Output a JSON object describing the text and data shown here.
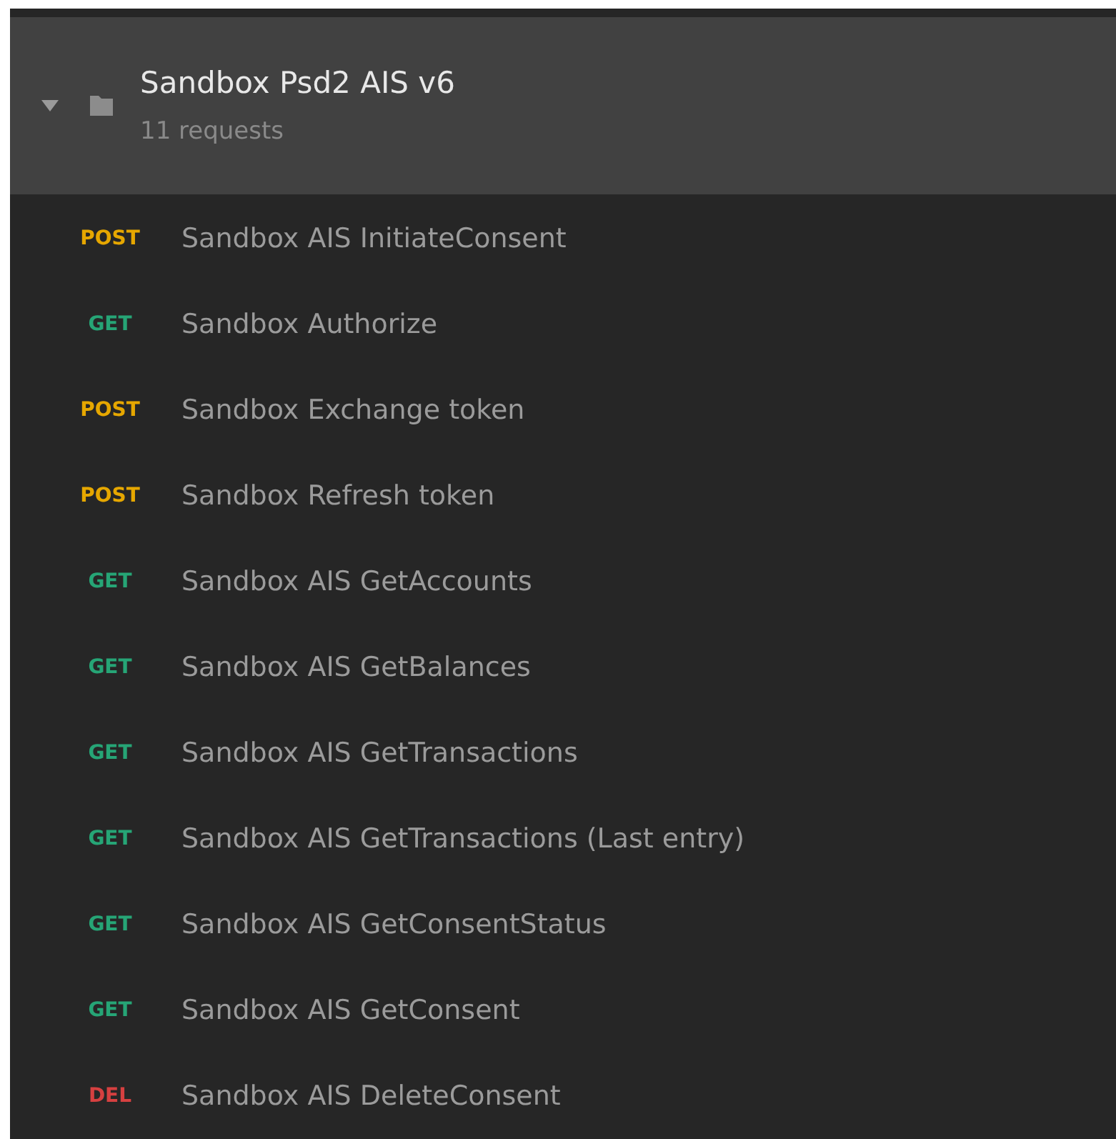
{
  "collection": {
    "title": "Sandbox Psd2 AIS v6",
    "subtitle": "11 requests",
    "expanded": true
  },
  "requests": [
    {
      "method": "POST",
      "kind": "post",
      "name": "Sandbox AIS InitiateConsent"
    },
    {
      "method": "GET",
      "kind": "get",
      "name": "Sandbox Authorize"
    },
    {
      "method": "POST",
      "kind": "post",
      "name": "Sandbox Exchange token"
    },
    {
      "method": "POST",
      "kind": "post",
      "name": "Sandbox Refresh token"
    },
    {
      "method": "GET",
      "kind": "get",
      "name": "Sandbox AIS GetAccounts"
    },
    {
      "method": "GET",
      "kind": "get",
      "name": "Sandbox AIS GetBalances"
    },
    {
      "method": "GET",
      "kind": "get",
      "name": "Sandbox AIS GetTransactions"
    },
    {
      "method": "GET",
      "kind": "get",
      "name": "Sandbox AIS GetTransactions (Last entry)"
    },
    {
      "method": "GET",
      "kind": "get",
      "name": "Sandbox AIS GetConsentStatus"
    },
    {
      "method": "GET",
      "kind": "get",
      "name": "Sandbox AIS GetConsent"
    },
    {
      "method": "DEL",
      "kind": "delete",
      "name": "Sandbox AIS DeleteConsent"
    }
  ]
}
